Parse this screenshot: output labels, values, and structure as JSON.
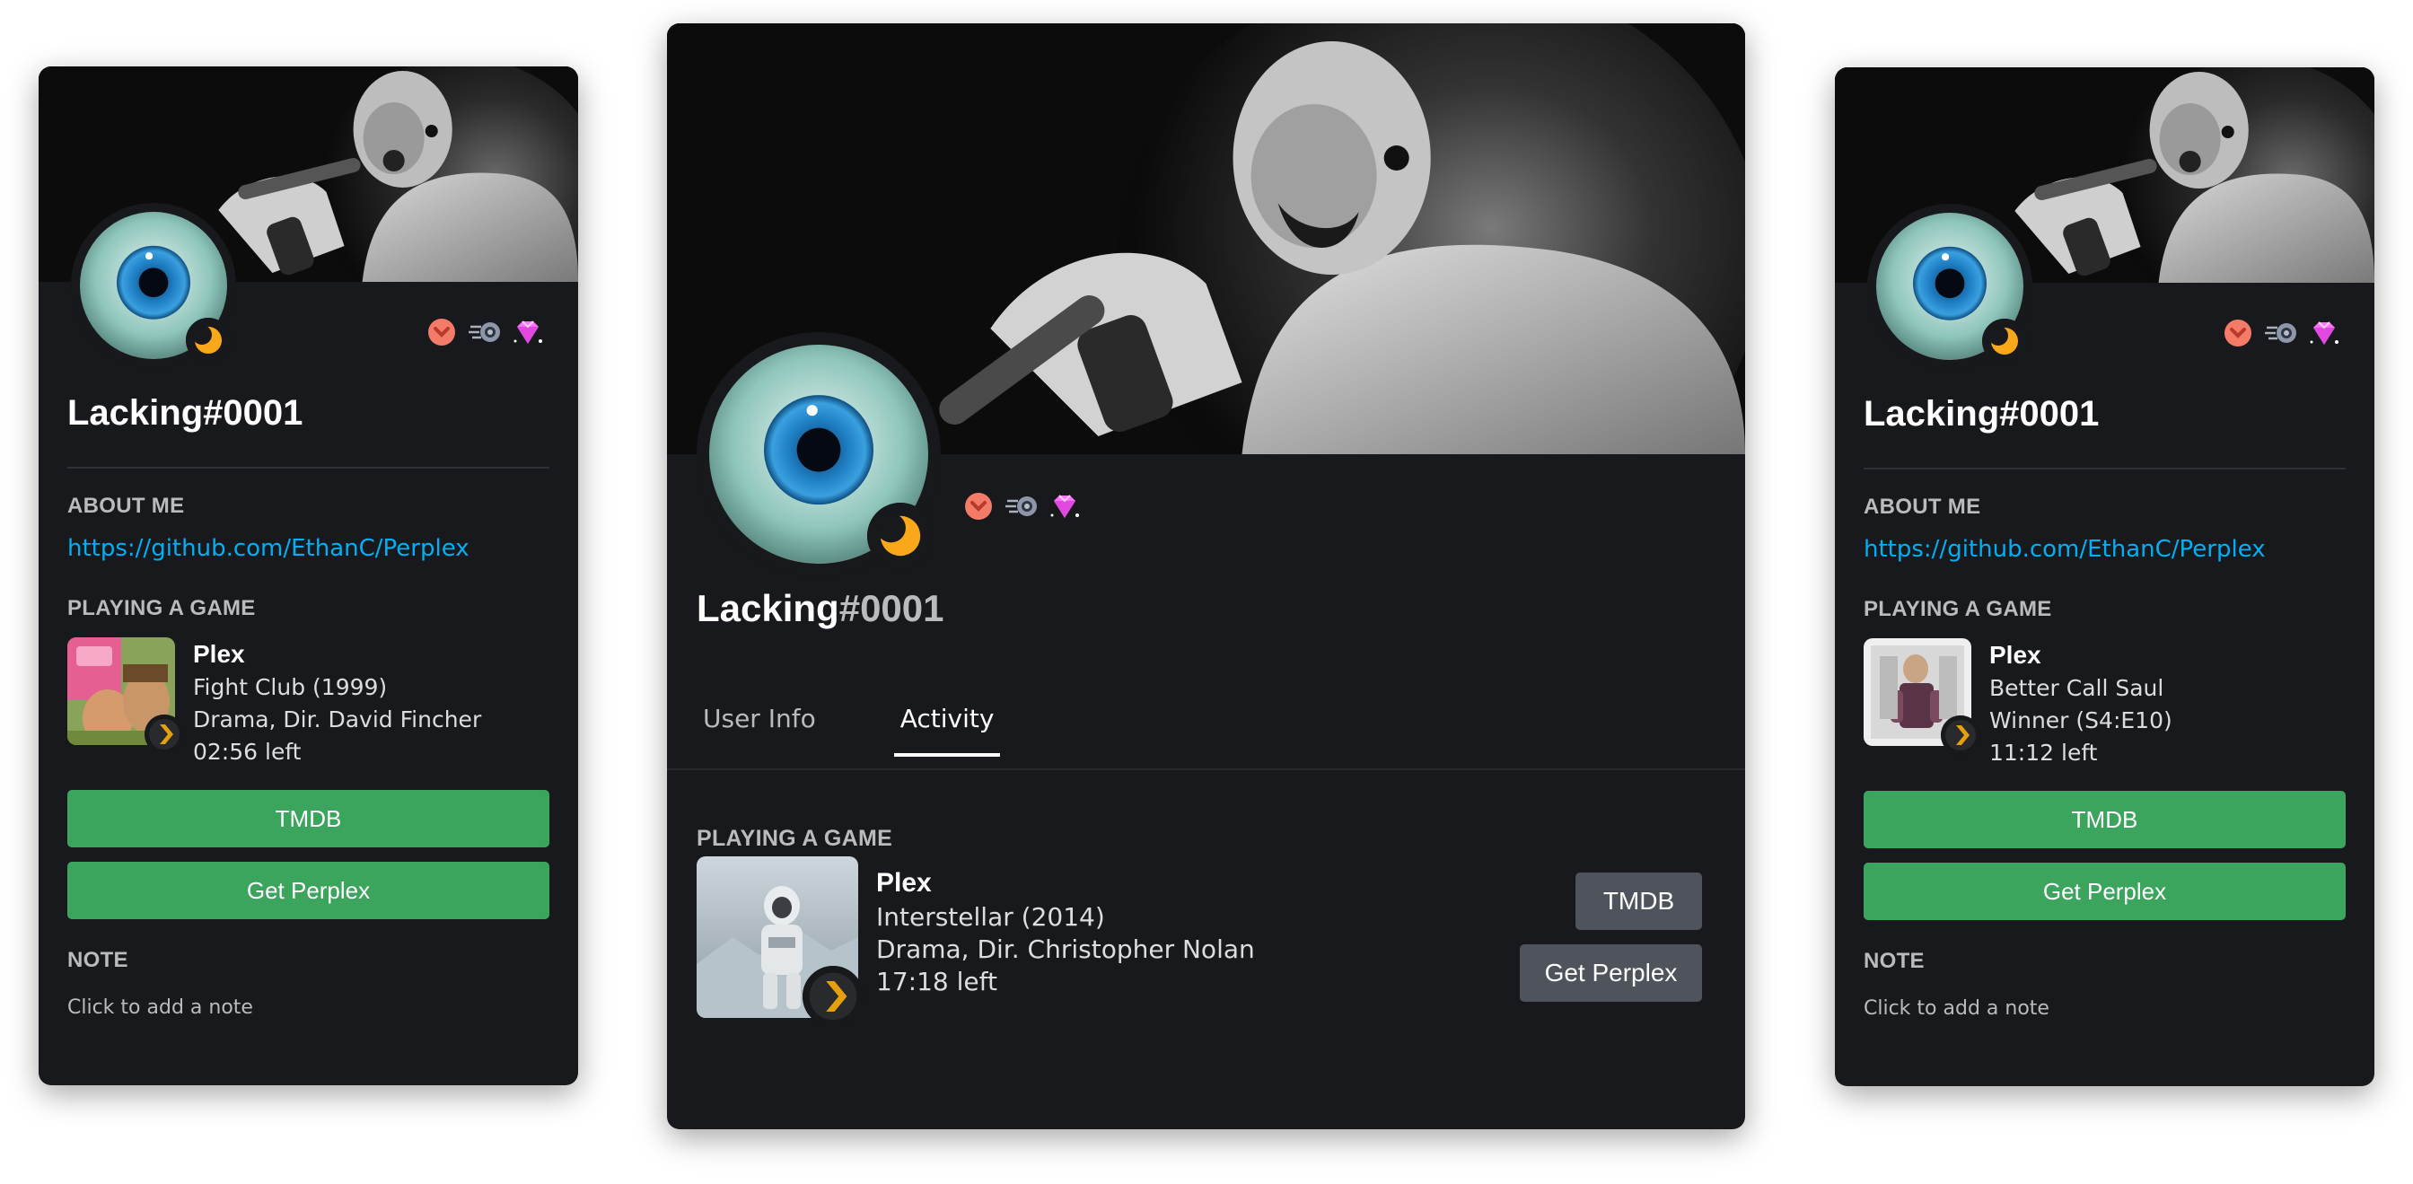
{
  "cards": {
    "left": {
      "username": "Lacking#0001",
      "about_title": "ABOUT ME",
      "about_link": "https://github.com/EthanC/Perplex",
      "playing_title": "PLAYING A GAME",
      "activity": {
        "name": "Plex",
        "line1": "Fight Club (1999)",
        "line2": "Drama, Dir. David Fincher",
        "line3": "02:56 left"
      },
      "buttons": [
        "TMDB",
        "Get Perplex"
      ],
      "note_title": "NOTE",
      "note_placeholder": "Click to add a note"
    },
    "center": {
      "username_name": "Lacking",
      "username_disc": "#0001",
      "tabs": [
        "User Info",
        "Activity"
      ],
      "active_tab": "Activity",
      "playing_title": "PLAYING A GAME",
      "activity": {
        "name": "Plex",
        "line1": "Interstellar (2014)",
        "line2": "Drama, Dir. Christopher Nolan",
        "line3": "17:18 left"
      },
      "buttons": [
        "TMDB",
        "Get Perplex"
      ]
    },
    "right": {
      "username": "Lacking#0001",
      "about_title": "ABOUT ME",
      "about_link": "https://github.com/EthanC/Perplex",
      "playing_title": "PLAYING A GAME",
      "activity": {
        "name": "Plex",
        "line1": "Better Call Saul",
        "line2": "Winner (S4:E10)",
        "line3": "11:12 left"
      },
      "buttons": [
        "TMDB",
        "Get Perplex"
      ],
      "note_title": "NOTE",
      "note_placeholder": "Click to add a note"
    }
  },
  "icons": {
    "status": "moon-idle-icon",
    "badges": [
      "hypesquad-badge-icon",
      "nitro-badge-icon",
      "boost-badge-icon"
    ],
    "activity_small": "plex-chevron-icon"
  },
  "colors": {
    "card_bg": "#18191c",
    "link": "#00aff4",
    "green_button": "#3ba55d",
    "grey_button": "#4f545c",
    "idle": "#faa81a"
  }
}
